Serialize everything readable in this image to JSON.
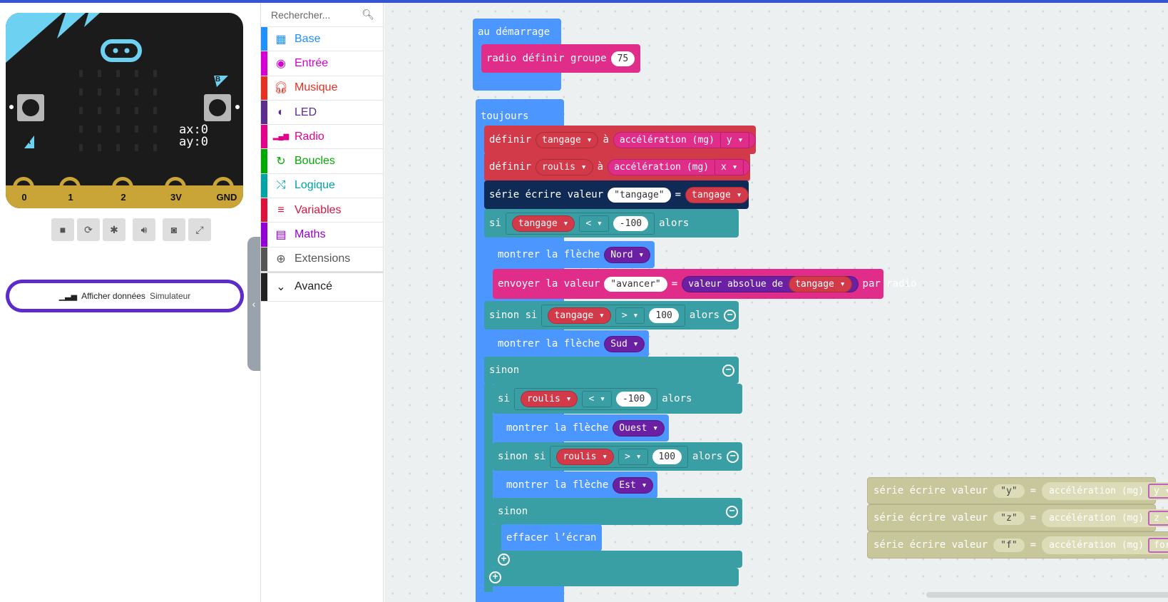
{
  "simulator": {
    "pins": [
      "0",
      "1",
      "2",
      "3V",
      "GND"
    ],
    "btn_a": "A",
    "btn_b": "B",
    "readout": {
      "ax": "ax:0",
      "ay": "ay:0"
    },
    "data_button": {
      "label": "Afficher données",
      "sub": "Simulateur"
    }
  },
  "toolbox": {
    "search_placeholder": "Rechercher...",
    "categories": [
      {
        "label": "Base",
        "color": "#1e90ff",
        "icon": "grid-icon"
      },
      {
        "label": "Entrée",
        "color": "#d400d4",
        "icon": "circle-dot-icon"
      },
      {
        "label": "Musique",
        "color": "#e63022",
        "icon": "headphones-icon"
      },
      {
        "label": "LED",
        "color": "#5c2d91",
        "icon": "toggle-icon"
      },
      {
        "label": "Radio",
        "color": "#e3008c",
        "icon": "signal-icon"
      },
      {
        "label": "Boucles",
        "color": "#00aa00",
        "icon": "refresh-icon"
      },
      {
        "label": "Logique",
        "color": "#00a4a6",
        "icon": "shuffle-icon"
      },
      {
        "label": "Variables",
        "color": "#dc143c",
        "icon": "list-icon"
      },
      {
        "label": "Maths",
        "color": "#9400d3",
        "icon": "calculator-icon"
      },
      {
        "label": "Extensions",
        "color": "#555555",
        "icon": "plus-circle-icon"
      },
      {
        "label": "Avancé",
        "color": "#222222",
        "icon": "chevron-down-icon"
      }
    ]
  },
  "blocks": {
    "on_start": "au démarrage",
    "radio_set": "radio définir groupe",
    "radio_group": "75",
    "forever": "toujours",
    "set": "définir",
    "var_pitch": "tangage",
    "var_roll": "roulis",
    "to": "à",
    "accel": "accélération (mg)",
    "axis_y": "y",
    "axis_x": "x",
    "serial": "série écrire valeur",
    "str_pitch": "tangage",
    "eq": "=",
    "if": "si",
    "then": "alors",
    "lt": "<",
    "gt": ">",
    "neg100": "-100",
    "pos100": "100",
    "show_arrow": "montrer la flèche",
    "north": "Nord",
    "south": "Sud",
    "west": "Ouest",
    "east": "Est",
    "send": "envoyer la valeur",
    "str_advance": "avancer",
    "abs": "valeur absolue de",
    "by_radio": "par radio",
    "else_if": "sinon si",
    "else": "sinon",
    "clear": "effacer l’écran",
    "ghost": [
      {
        "key": "y",
        "axis": "y"
      },
      {
        "key": "z",
        "axis": "z"
      },
      {
        "key": "f",
        "axis": "force"
      }
    ]
  }
}
